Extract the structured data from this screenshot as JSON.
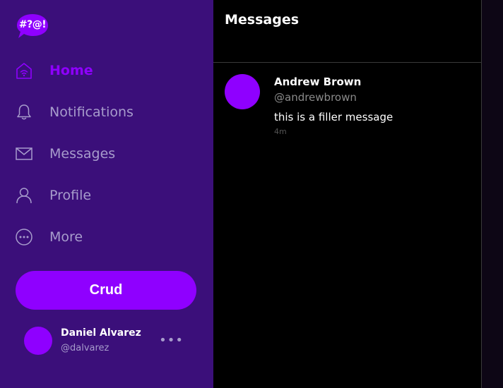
{
  "logo": {
    "text": "#?@!"
  },
  "sidebar": {
    "items": [
      {
        "label": "Home",
        "icon": "home-icon",
        "active": true
      },
      {
        "label": "Notifications",
        "icon": "bell-icon",
        "active": false
      },
      {
        "label": "Messages",
        "icon": "envelope-icon",
        "active": false
      },
      {
        "label": "Profile",
        "icon": "user-icon",
        "active": false
      },
      {
        "label": "More",
        "icon": "more-circle-icon",
        "active": false
      }
    ],
    "crud_label": "Crud"
  },
  "user": {
    "name": "Daniel Alvarez",
    "handle": "@dalvarez",
    "more_glyph": "•••"
  },
  "main": {
    "title": "Messages",
    "messages": [
      {
        "name": "Andrew Brown",
        "handle": "@andrewbrown",
        "text": "this is a filler message",
        "time": "4m"
      }
    ]
  },
  "colors": {
    "sidebar_bg": "#3b0f7a",
    "accent": "#8f00ff",
    "muted": "#a79ccc",
    "background": "#000000"
  }
}
